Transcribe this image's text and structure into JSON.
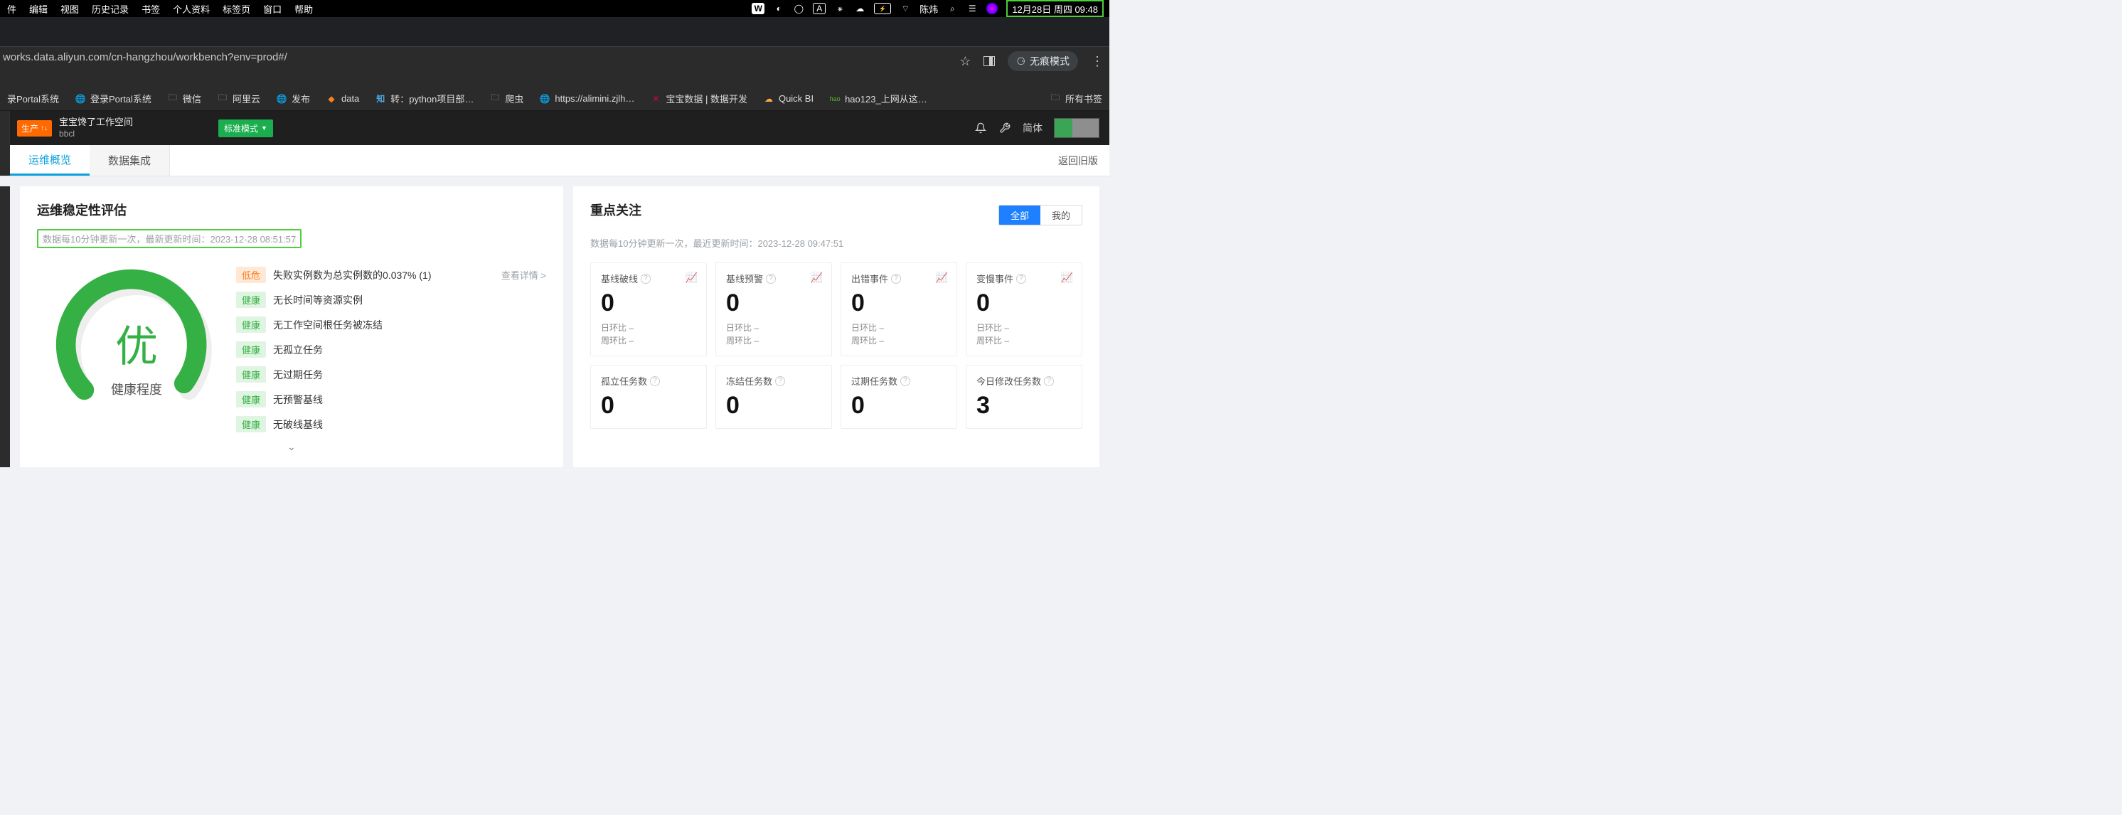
{
  "mac_menu": {
    "items": [
      "件",
      "编辑",
      "视图",
      "历史记录",
      "书签",
      "个人资料",
      "标签页",
      "窗口",
      "帮助"
    ],
    "user": "陈炜",
    "clock": "12月28日 周四 09:48"
  },
  "browser": {
    "url": "works.data.aliyun.com/cn-hangzhou/workbench?env=prod#/",
    "incognito_label": "无痕模式"
  },
  "bookmarks": {
    "items": [
      {
        "label": "录Portal系统",
        "icon": "generic"
      },
      {
        "label": "登录Portal系统",
        "icon": "globe"
      },
      {
        "label": "微信",
        "icon": "folder"
      },
      {
        "label": "阿里云",
        "icon": "folder"
      },
      {
        "label": "发布",
        "icon": "globe"
      },
      {
        "label": "data",
        "icon": "diamond"
      },
      {
        "label": "转：python项目部…",
        "icon": "zhihu"
      },
      {
        "label": "爬虫",
        "icon": "folder"
      },
      {
        "label": "https://alimini.zjlh…",
        "icon": "globe"
      },
      {
        "label": "宝宝数据 | 数据开发",
        "icon": "wrench"
      },
      {
        "label": "Quick BI",
        "icon": "cloud"
      },
      {
        "label": "hao123_上网从这…",
        "icon": "hao"
      }
    ],
    "all_label": "所有书签"
  },
  "app_header": {
    "env_tag": "生产",
    "workspace_name": "宝宝馋了工作空间",
    "workspace_sub": "bbcl",
    "mode_label": "标准模式",
    "lang_label": "简体"
  },
  "tabs": {
    "items": [
      "运维概览",
      "数据集成"
    ],
    "active_index": 0,
    "back_old_label": "返回旧版"
  },
  "stability_panel": {
    "title": "运维稳定性评估",
    "update_note": "数据每10分钟更新一次，最新更新时间：2023-12-28 08:51:57",
    "gauge_center": "优",
    "gauge_label": "健康程度",
    "rows": [
      {
        "tag": "低危",
        "tag_type": "low",
        "text": "失败实例数为总实例数的0.037%  (1)",
        "detail": "查看详情 >"
      },
      {
        "tag": "健康",
        "tag_type": "health",
        "text": "无长时间等资源实例"
      },
      {
        "tag": "健康",
        "tag_type": "health",
        "text": "无工作空间根任务被冻结"
      },
      {
        "tag": "健康",
        "tag_type": "health",
        "text": "无孤立任务"
      },
      {
        "tag": "健康",
        "tag_type": "health",
        "text": "无过期任务"
      },
      {
        "tag": "健康",
        "tag_type": "health",
        "text": "无预警基线"
      },
      {
        "tag": "健康",
        "tag_type": "health",
        "text": "无破线基线"
      }
    ]
  },
  "focus_panel": {
    "title": "重点关注",
    "update_note": "数据每10分钟更新一次，最近更新时间：2023-12-28 09:47:51",
    "toggle": {
      "all": "全部",
      "mine": "我的",
      "active": "all"
    },
    "cards_top": [
      {
        "title": "基线破线",
        "value": "0",
        "day": "日环比 –",
        "week": "周环比 –",
        "chart": true
      },
      {
        "title": "基线预警",
        "value": "0",
        "day": "日环比 –",
        "week": "周环比 –",
        "chart": true
      },
      {
        "title": "出错事件",
        "value": "0",
        "day": "日环比 –",
        "week": "周环比 –",
        "chart": true
      },
      {
        "title": "变慢事件",
        "value": "0",
        "day": "日环比 –",
        "week": "周环比 –",
        "chart": true
      }
    ],
    "cards_bottom": [
      {
        "title": "孤立任务数",
        "value": "0"
      },
      {
        "title": "冻结任务数",
        "value": "0"
      },
      {
        "title": "过期任务数",
        "value": "0"
      },
      {
        "title": "今日修改任务数",
        "value": "3"
      }
    ]
  }
}
